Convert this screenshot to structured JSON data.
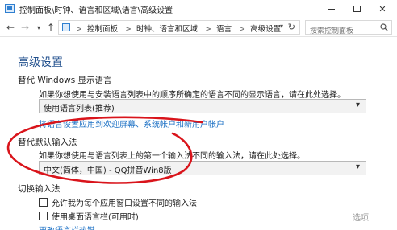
{
  "window": {
    "title": "控制面板\\时钟、语言和区域\\语言\\高级设置",
    "minimize": "—",
    "maximize": "☐",
    "close": "✕"
  },
  "nav": {
    "back": "←",
    "forward": "→",
    "recent": "▾",
    "up": "↑",
    "breadcrumbs": [
      "控制面板",
      "时钟、语言和区域",
      "语言",
      "高级设置"
    ],
    "separator": ">",
    "dropdown": "▾",
    "refresh": "↻",
    "search_placeholder": "搜索控制面板"
  },
  "page": {
    "title": "高级设置",
    "display_language": {
      "heading": "替代 Windows 显示语言",
      "description": "如果你想使用与安装语言列表中的顺序所确定的语言不同的显示语言，请在此处选择。",
      "selected": "使用语言列表(推荐)",
      "apply_link": "将语言设置应用到欢迎屏幕、系统帐户和新用户帐户"
    },
    "input_method": {
      "heading": "替代默认输入法",
      "description": "如果你想使用与语言列表上的第一个输入法不同的输入法，请在此处选择。",
      "selected": "中文(简体，中国) - QQ拼音Win8版"
    },
    "switching": {
      "heading": "切换输入法",
      "checkbox1": "允许我为每个应用窗口设置不同的输入法",
      "checkbox2": "使用桌面语言栏(可用时)",
      "options_link": "选项",
      "hotkey_link": "更改语言栏热键"
    }
  },
  "colors": {
    "title_blue": "#1f4e8c",
    "link_blue": "#1a6fc4",
    "annotation_red": "#d9141b"
  },
  "icons": {
    "app": "control-panel-icon",
    "search": "search-icon",
    "dropdown": "chevron-down-icon"
  }
}
